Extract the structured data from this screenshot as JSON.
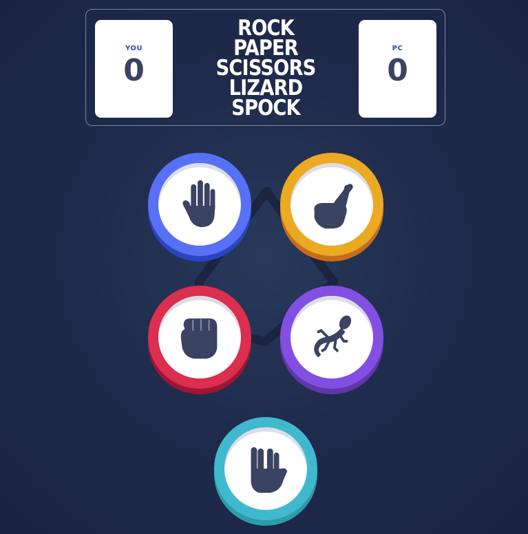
{
  "scoreboard": {
    "title_lines": [
      "ROCK",
      "PAPER",
      "SCISSORS",
      "LIZARD",
      "SPOCK"
    ],
    "you_label": "YOU",
    "you_score": "0",
    "pc_label": "PC",
    "pc_score": "0"
  },
  "choices": [
    {
      "name": "paper",
      "icon": "hand-paper-icon",
      "color": "#5671f5",
      "shadow": "#2a45c2"
    },
    {
      "name": "scissors",
      "icon": "hand-scissors-icon",
      "color": "#eca922",
      "shadow": "#c76c1b"
    },
    {
      "name": "rock",
      "icon": "hand-rock-icon",
      "color": "#dc2e4e",
      "shadow": "#9d1634"
    },
    {
      "name": "lizard",
      "icon": "lizard-icon",
      "color": "#834fe3",
      "shadow": "#5f37a8"
    },
    {
      "name": "spock",
      "icon": "hand-spock-icon",
      "color": "#40b9ce",
      "shadow": "#2e9ba9"
    }
  ],
  "colors": {
    "background": "#1f2b4c",
    "icon": "#3b4363",
    "score_label": "#2a46c0"
  }
}
